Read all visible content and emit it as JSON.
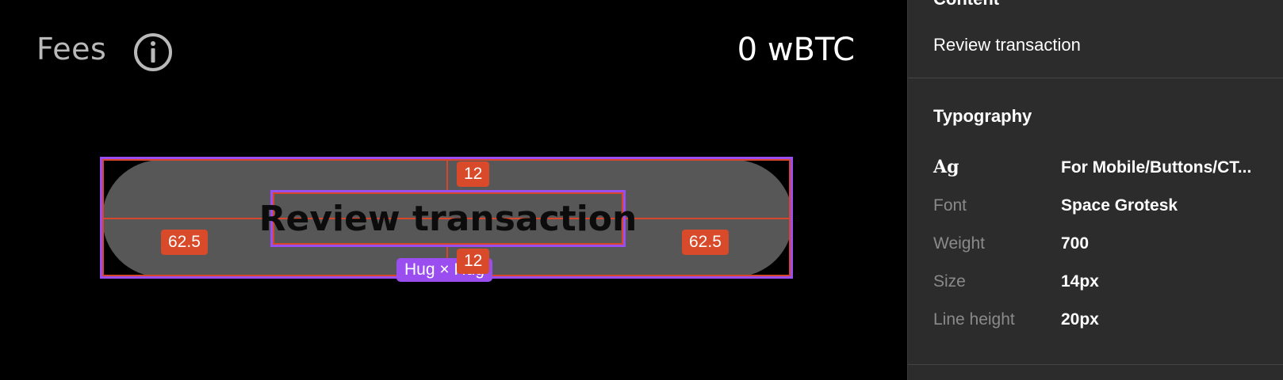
{
  "canvas": {
    "fees_label": "Fees",
    "amount": "0 wBTC",
    "button_label": "Review transaction",
    "padding_top": "12",
    "padding_bottom": "12",
    "padding_left": "62.5",
    "padding_right": "62.5",
    "sizing_badge": "Hug × Hug"
  },
  "panel": {
    "section_title": "Content",
    "content_value": "Review transaction",
    "typography": {
      "title": "Typography",
      "style_icon": "Ag",
      "style_name": "For Mobile/Buttons/CT...",
      "rows": [
        {
          "label": "Font",
          "value": "Space Grotesk"
        },
        {
          "label": "Weight",
          "value": "700"
        },
        {
          "label": "Size",
          "value": "14px"
        },
        {
          "label": "Line height",
          "value": "20px"
        }
      ]
    }
  },
  "colors": {
    "selection": "#9b4ef0",
    "spacing": "#d6462a",
    "button_bg": "#575757",
    "panel_bg": "#2c2c2c"
  }
}
